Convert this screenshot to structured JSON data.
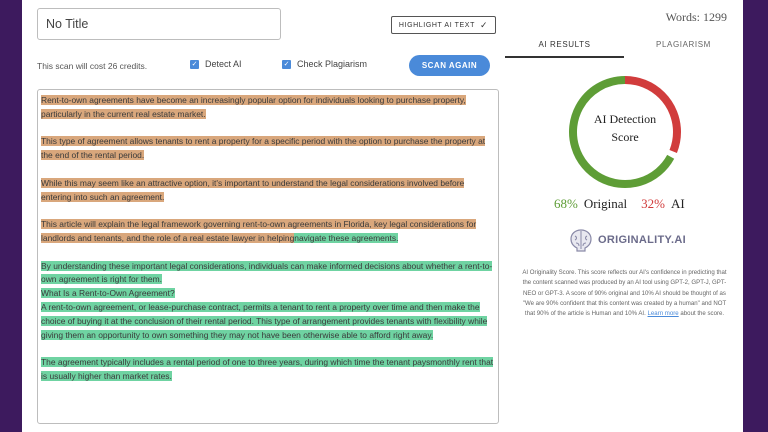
{
  "header": {
    "title_value": "No Title",
    "highlight_label": "HIGHLIGHT AI TEXT",
    "cost_text": "This scan will cost 26 credits.",
    "detect_ai_label": "Detect AI",
    "check_plagiarism_label": "Check Plagiarism",
    "scan_label": "SCAN AGAIN"
  },
  "words": "Words: 1299",
  "tabs": {
    "ai_results": "AI RESULTS",
    "plagiarism": "PLAGIARISM"
  },
  "gauge": {
    "line1": "AI Detection",
    "line2": "Score",
    "original_fraction": 0.68
  },
  "score": {
    "original_pct": "68%",
    "original_label": "Original",
    "ai_pct": "32%",
    "ai_label": "AI"
  },
  "logo_text": "ORIGINALITY.AI",
  "description": {
    "text": "AI Originality Score. This score reflects our AI's confidence in predicting that the content scanned was produced by an AI tool using GPT-2, GPT-J, GPT-NEO or GPT-3. A score of 90% original and 10% AI should be thought of as \"We are 90% confident that this content was created by a human\" and NOT that 90% of the article is Human and 10% AI.",
    "link": "Learn more",
    "tail": "about the score."
  },
  "colors": {
    "ai_highlight": "#d9a77c",
    "original_highlight": "#6fd3a2",
    "gauge_green": "#5e9d36",
    "gauge_red": "#d13c3c",
    "accent": "#4a8ad9"
  },
  "content": {
    "p1": "Rent-to-own agreements have become an increasingly popular option for individuals looking to purchase property, particularly in the current real estate market.",
    "p2": "This type of agreement allows tenants to rent a property for a specific period with the option to purchase the property at the end of the rental period.",
    "p3": "While this may seem like an attractive option, it's important to understand the legal considerations involved before entering into such an agreement.",
    "p4a": "This article will explain the legal framework governing rent-to-own agreements in Florida, key legal considerations for landlords and tenants, and the role of a real estate lawyer in helping",
    "p4b": "navigate these agreements.",
    "p5": "By understanding these important legal considerations, individuals can make informed decisions about whether a rent-to-own agreement is right for them.",
    "p6": "What Is a Rent-to-Own Agreement?",
    "p7": "A rent-to-own agreement, or lease-purchase contract, permits a tenant to rent a property over time and then make the choice of buying it at the conclusion of their rental period. This type of arrangement provides tenants with flexibility while giving them an opportunity to own something they may not have been otherwise able to afford right away.",
    "p8": "The agreement typically includes a rental period of one to three years, during which time the tenant paysmonthly rent that is usually higher than market rates."
  }
}
